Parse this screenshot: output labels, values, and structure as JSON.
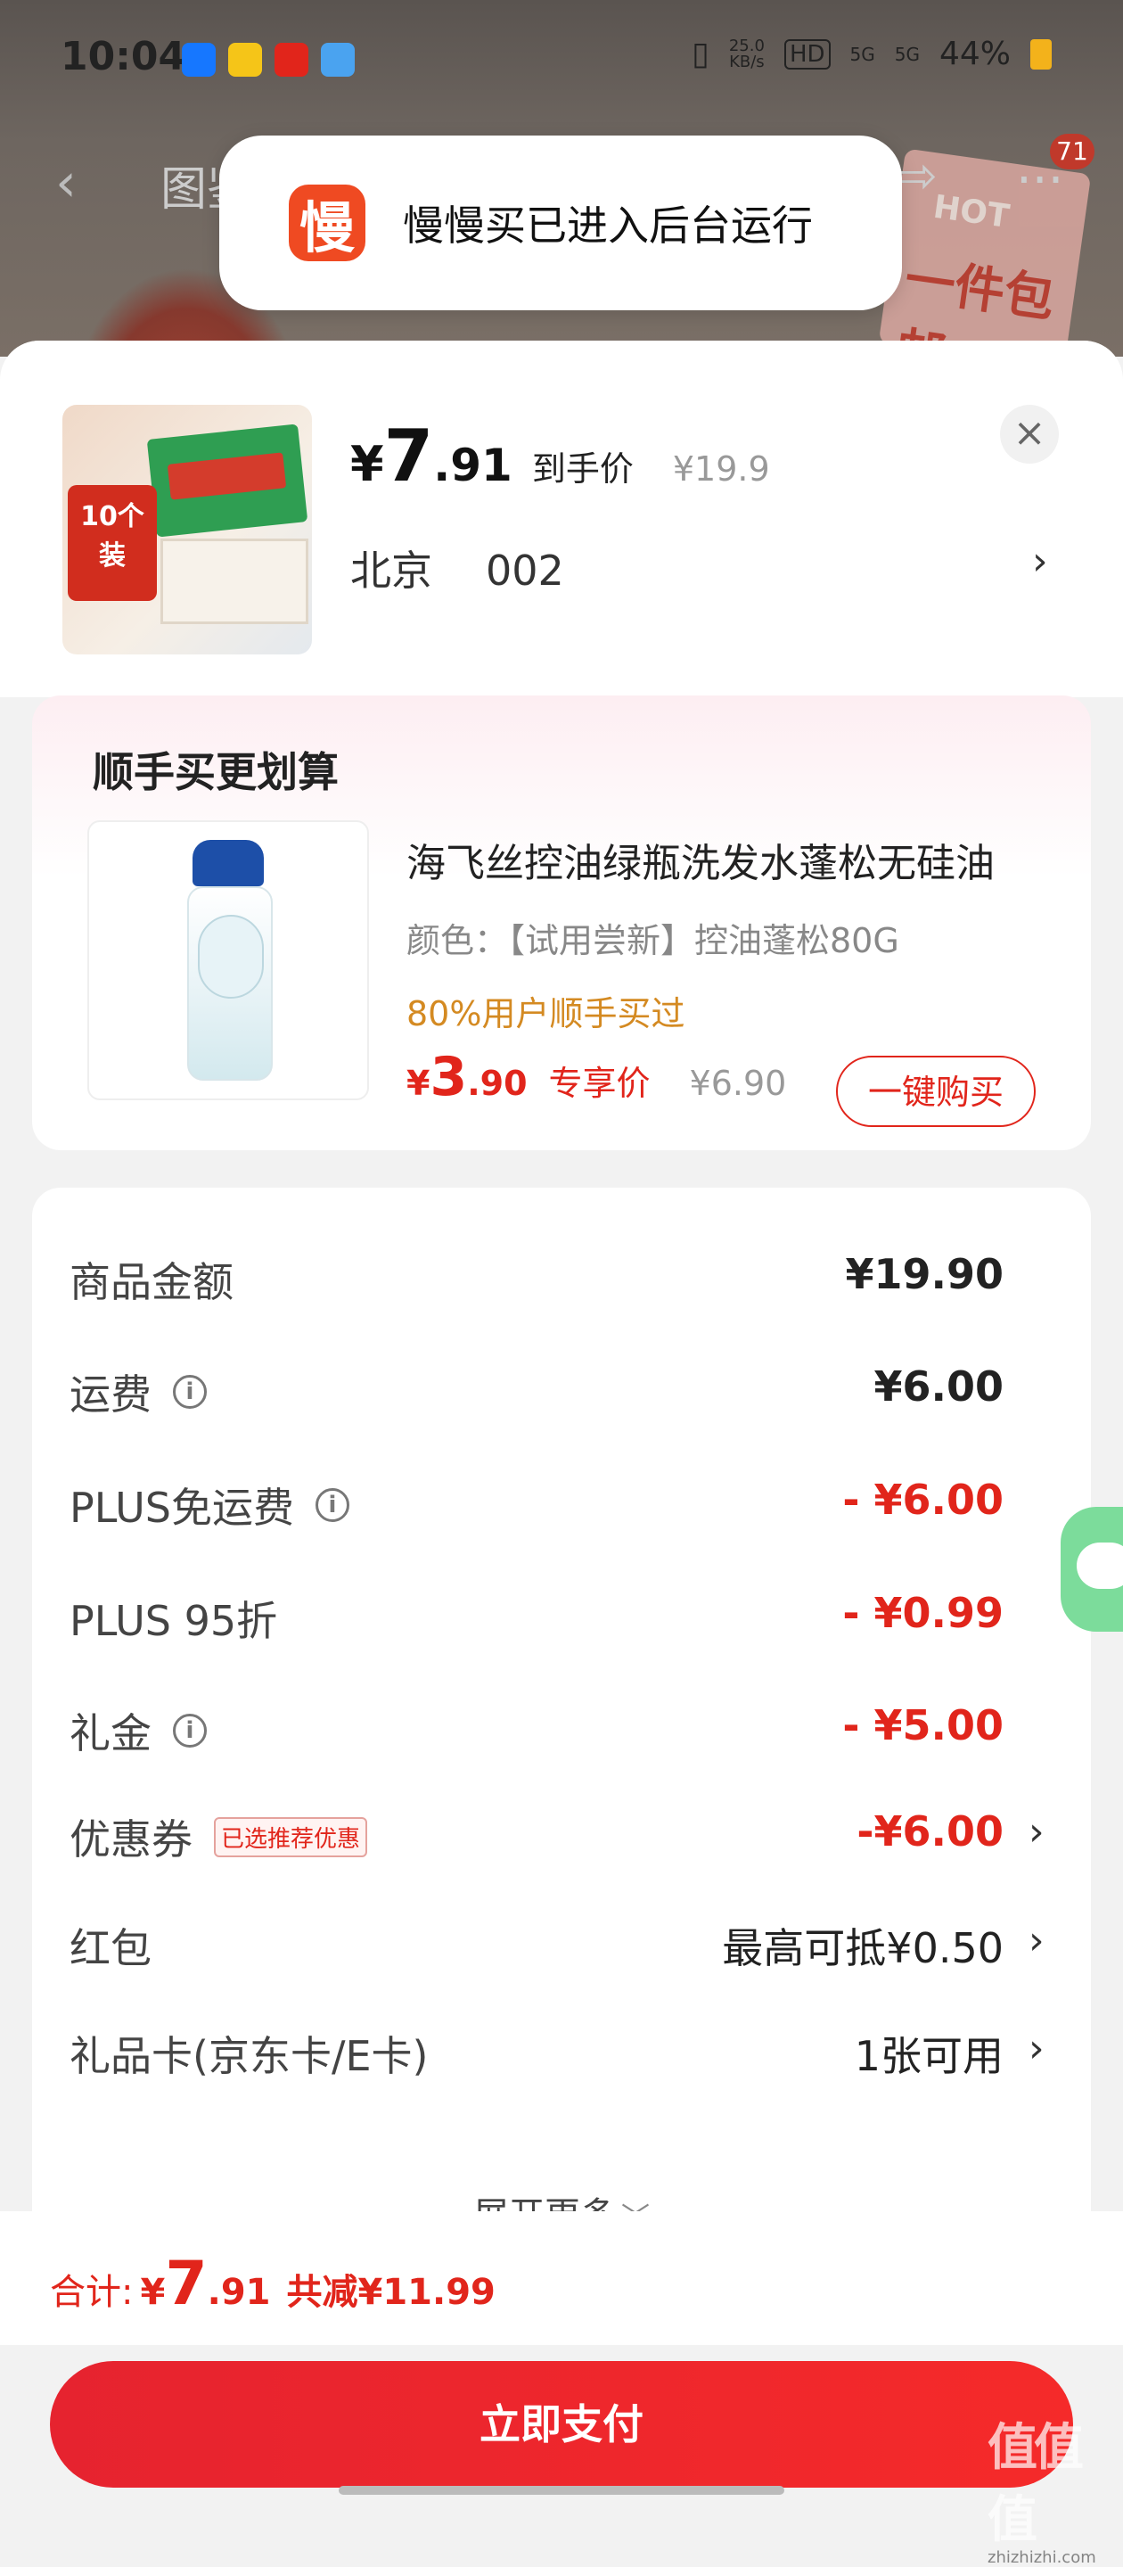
{
  "status_bar": {
    "time": "10:04",
    "network_speed_top": "25.0",
    "network_speed_bottom": "KB/s",
    "hd_label": "HD",
    "sig1": "5G",
    "sig2": "5G",
    "battery": "44%"
  },
  "background_page": {
    "title": "图鉴",
    "cart_count": "71",
    "hot_badge_text": "HOT",
    "hot_badge_big": "一件包邮"
  },
  "toast": {
    "icon_char": "慢",
    "text": "慢慢买已进入后台运行"
  },
  "product": {
    "image_tag": "10个装",
    "price_symbol": "¥",
    "price_int": "7",
    "price_dec": ".91",
    "price_label": "到手价",
    "original_price": "¥19.9",
    "city": "北京",
    "district": "002"
  },
  "cross_sell": {
    "title": "顺手买更划算",
    "name": "海飞丝控油绿瓶洗发水蓬松无硅油",
    "spec": "颜色：【试用尝新】控油蓬松80G",
    "social_proof": "80%用户顺手买过",
    "price_symbol": "¥",
    "price_int": "3",
    "price_dec": ".90",
    "price_label": "专享价",
    "original_price": "¥6.90",
    "buy_button": "一键购买"
  },
  "cost_rows": [
    {
      "label": "商品金额",
      "value": "¥19.90",
      "info": false,
      "style": "bold"
    },
    {
      "label": "运费",
      "value": "¥6.00",
      "info": true,
      "style": "bold"
    },
    {
      "label": "PLUS免运费",
      "value": "- ¥6.00",
      "info": true,
      "style": "red"
    },
    {
      "label": "PLUS 95折",
      "value": "- ¥0.99",
      "info": false,
      "style": "red"
    },
    {
      "label": "礼金",
      "value": "- ¥5.00",
      "info": true,
      "style": "red"
    },
    {
      "label": "优惠券",
      "badge": "已选推荐优惠",
      "value": "-¥6.00",
      "info": false,
      "style": "red",
      "chevron": true
    },
    {
      "label": "红包",
      "value": "最高可抵¥0.50",
      "info": false,
      "style": "normal",
      "chevron": true
    },
    {
      "label": "礼品卡(京东卡/E卡)",
      "value": "1张可用",
      "info": false,
      "style": "normal",
      "chevron": true
    }
  ],
  "expand_more": "展开更多",
  "total": {
    "label": "合计:",
    "symbol": "¥",
    "int": "7",
    "dec": ".91",
    "saved": "共减¥11.99"
  },
  "pay_button": "立即支付",
  "watermark": {
    "text": "值值值",
    "domain": "zhizhizhi.com"
  },
  "colors": {
    "accent_red": "#e1251b",
    "social_orange": "#d48a22",
    "toast_icon_orange": "#ef4a22",
    "chat_green": "#7cdc9b"
  },
  "icons": {
    "close": "close-icon",
    "chevron_right": "chevron-right-icon",
    "info": "info-icon",
    "chevron_down": "chevron-down-icon",
    "chat": "chat-icon"
  }
}
